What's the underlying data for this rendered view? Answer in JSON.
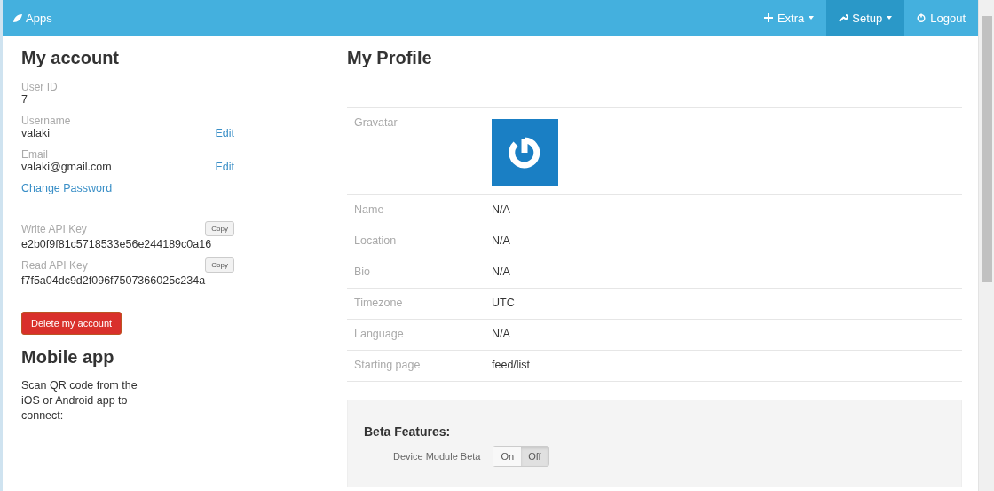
{
  "navbar": {
    "brand": "Apps",
    "items": [
      {
        "label": "Extra",
        "kind": "dropdown",
        "selected": false
      },
      {
        "label": "Setup",
        "kind": "dropdown",
        "selected": true
      },
      {
        "label": "Logout",
        "kind": "link",
        "selected": false
      }
    ]
  },
  "account": {
    "title": "My account",
    "fields": [
      {
        "label": "User ID",
        "value": "7"
      },
      {
        "label": "Username",
        "value": "valaki",
        "action": "Edit"
      },
      {
        "label": "Email",
        "value": "valaki@gmail.com",
        "action": "Edit"
      }
    ],
    "change_password": "Change Password",
    "api_keys": [
      {
        "label": "Write API Key",
        "value": "e2b0f9f81c5718533e56e244189c0a16",
        "button": "Copy"
      },
      {
        "label": "Read API Key",
        "value": "f7f5a04dc9d2f096f7507366025c234a",
        "button": "Copy"
      }
    ],
    "delete_button": "Delete my account"
  },
  "mobile_app": {
    "title": "Mobile app",
    "text": "Scan QR code from the iOS or Android app to connect:"
  },
  "profile": {
    "title": "My Profile",
    "rows": [
      {
        "label": "Gravatar",
        "kind": "avatar"
      },
      {
        "label": "Name",
        "value": "N/A",
        "kind": "text"
      },
      {
        "label": "Location",
        "value": "N/A",
        "kind": "text"
      },
      {
        "label": "Bio",
        "value": "N/A",
        "kind": "text"
      },
      {
        "label": "Timezone",
        "value": "UTC",
        "kind": "text"
      },
      {
        "label": "Language",
        "value": "N/A",
        "kind": "text"
      },
      {
        "label": "Starting page",
        "value": "feed/list",
        "kind": "text"
      }
    ]
  },
  "beta": {
    "title": "Beta Features:",
    "settings": [
      {
        "label": "Device Module Beta",
        "options": [
          {
            "label": "On",
            "selected": false
          },
          {
            "label": "Off",
            "selected": true
          }
        ]
      }
    ]
  }
}
